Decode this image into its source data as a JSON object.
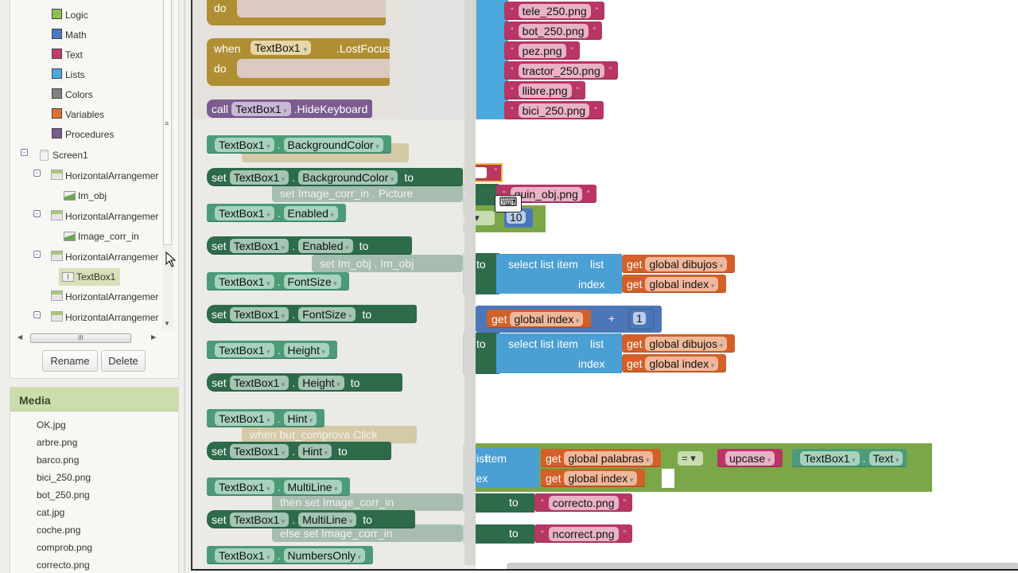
{
  "blocks_palette": [
    {
      "label": "Logic",
      "color": "#8cc152"
    },
    {
      "label": "Math",
      "color": "#4a7bc4"
    },
    {
      "label": "Text",
      "color": "#c03f6a"
    },
    {
      "label": "Lists",
      "color": "#4aa8dc"
    },
    {
      "label": "Colors",
      "color": "#808080"
    },
    {
      "label": "Variables",
      "color": "#e07030"
    },
    {
      "label": "Procedures",
      "color": "#7a5c90"
    }
  ],
  "tree": {
    "screen": "Screen1",
    "items": [
      {
        "label": "HorizontalArrangemer",
        "child": "Im_obj"
      },
      {
        "label": "HorizontalArrangemer",
        "child": "Image_corr_in"
      },
      {
        "label": "HorizontalArrangemer",
        "child": "TextBox1"
      },
      {
        "label": "HorizontalArrangemer"
      },
      {
        "label": "HorizontalArrangemer"
      }
    ]
  },
  "buttons": {
    "rename": "Rename",
    "delete": "Delete"
  },
  "media": {
    "title": "Media",
    "files": [
      "OK.jpg",
      "arbre.png",
      "barco.png",
      "bici_250.png",
      "bot_250.png",
      "cat.jpg",
      "coche.png",
      "comprob.png",
      "correcto.png"
    ]
  },
  "flyout": {
    "component": "TextBox1",
    "do": "do",
    "when": "when",
    "lostfocus": ".LostFocus",
    "call": "call",
    "hidekeyboard": ".HideKeyboard",
    "set": "set",
    "to": "to",
    "dot": ".",
    "properties": [
      "BackgroundColor",
      "Enabled",
      "FontSize",
      "Height",
      "Hint",
      "MultiLine",
      "NumbersOnly"
    ]
  },
  "workspace": {
    "strings": [
      "tele_250.png",
      "bot_250.png",
      "pez.png",
      "tractor_250.png",
      "llibre.png",
      "bici_250.png"
    ],
    "quin_obj": "quin_obj.png",
    "ten": "10",
    "select_list_item": "select list item",
    "list": "list",
    "index": "index",
    "get": "get",
    "global_dibujos": "global dibujos",
    "global_index": "global index",
    "global_palabras": "global palabras",
    "plus": "+",
    "one": "1",
    "eq": "=",
    "upcase": "upcase",
    "text_prop": "Text",
    "correcto": "correcto.png",
    "incorrect": "ncorrect.png",
    "picture": "Picture",
    "ghost": {
      "image_corr_in": "Image_corr_in",
      "im_obj": "Im_obj",
      "when": "when",
      "but_comprova": "but_comprova",
      "click": "Click",
      "then": "then",
      "else": "else"
    }
  }
}
